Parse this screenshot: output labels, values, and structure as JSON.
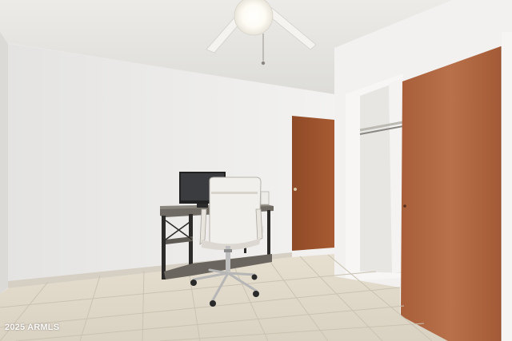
{
  "scene": {
    "description_tag": "bedroom-office-photo",
    "colors": {
      "wall": "#f0efed",
      "ceiling": "#e8e7e4",
      "floor_tile": "#ddd6c7",
      "grout": "#c9c1b1",
      "door_wood": "#a0522d",
      "closet_door": "#b06a45",
      "baseboard": "#d8d2c6"
    }
  },
  "watermark": {
    "text": "2025 ARMLS"
  }
}
